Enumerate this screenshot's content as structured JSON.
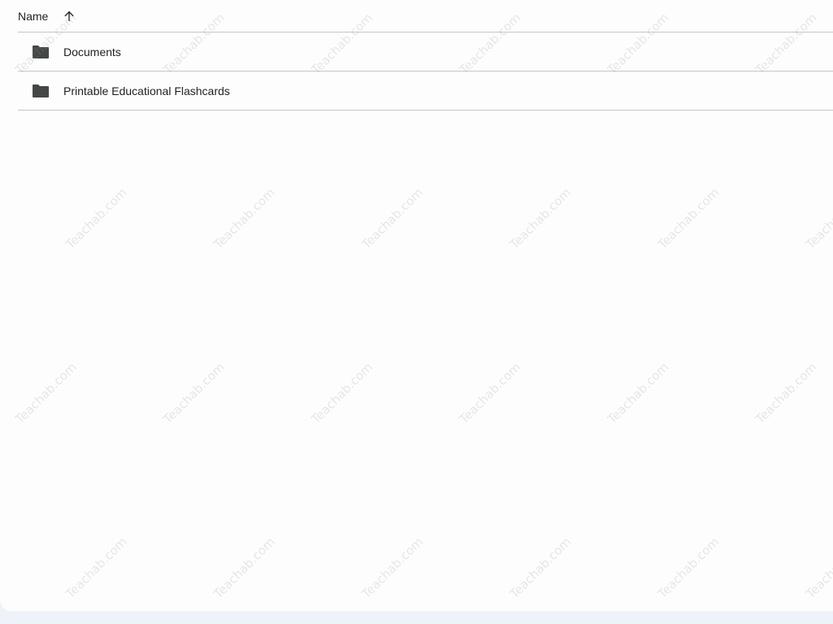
{
  "header": {
    "name_label": "Name",
    "sort_icon": "arrow-up-icon"
  },
  "files": [
    {
      "name": "Documents",
      "icon": "folder-icon"
    },
    {
      "name": "Printable Educational Flashcards",
      "icon": "folder-icon"
    }
  ],
  "watermark": {
    "text": "Teachab.com"
  },
  "colors": {
    "background": "#fdfdfd",
    "outer": "#eef3f9",
    "divider": "#c4c7c5",
    "folder": "#444746"
  }
}
